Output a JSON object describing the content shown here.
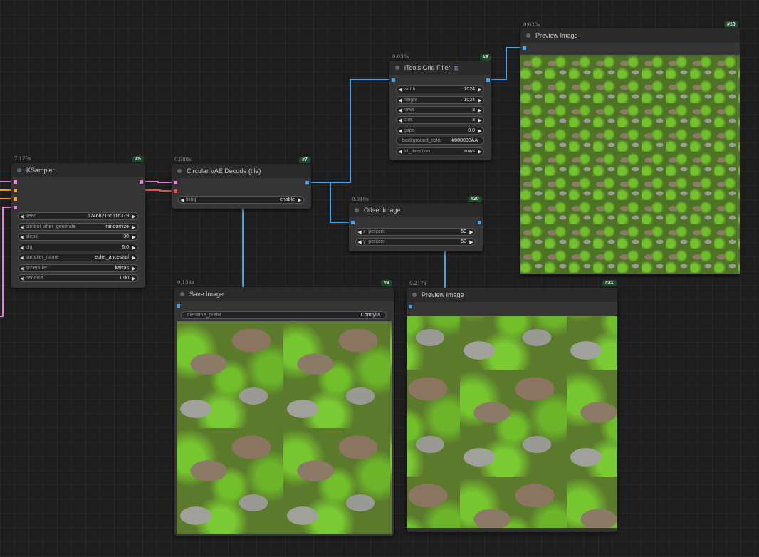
{
  "colors": {
    "wire_blue": "#4aa3e8",
    "wire_pink": "#e17fd8",
    "wire_orange": "#e6a032",
    "wire_red": "#e65050",
    "badge_bg": "#1f4a2b",
    "node_bg": "#353535"
  },
  "nodes": {
    "ksampler": {
      "id": "#5",
      "time": "7.176s",
      "title": "KSampler",
      "widgets": [
        {
          "label": "seed",
          "value": "174682155116379"
        },
        {
          "label": "control_after_generate",
          "value": "randomize"
        },
        {
          "label": "steps",
          "value": "30"
        },
        {
          "label": "cfg",
          "value": "6.0"
        },
        {
          "label": "sampler_name",
          "value": "euler_ancestral"
        },
        {
          "label": "scheduler",
          "value": "karras"
        },
        {
          "label": "denoise",
          "value": "1.00"
        }
      ]
    },
    "vae_decode": {
      "id": "#7",
      "time": "0.588s",
      "title": "Circular VAE Decode (tile)",
      "widgets": [
        {
          "label": "tiling",
          "value": "enable"
        }
      ]
    },
    "grid_filler": {
      "id": "#9",
      "time": "0.038s",
      "title": "iTools Grid Filler",
      "title_icon": "grid-icon",
      "widgets": [
        {
          "label": "width",
          "value": "1024"
        },
        {
          "label": "height",
          "value": "1024"
        },
        {
          "label": "rows",
          "value": "3"
        },
        {
          "label": "cols",
          "value": "3"
        },
        {
          "label": "gaps",
          "value": "0.0"
        },
        {
          "label": "background_color",
          "value": "#000000AA"
        },
        {
          "label": "fill_direction",
          "value": "rows"
        }
      ]
    },
    "preview10": {
      "id": "#10",
      "time": "0.030s",
      "title": "Preview Image"
    },
    "offset": {
      "id": "#20",
      "time": "0.010s",
      "title": "Offset Image",
      "widgets": [
        {
          "label": "x_percent",
          "value": "50"
        },
        {
          "label": "y_percent",
          "value": "50"
        }
      ]
    },
    "save": {
      "id": "#8",
      "time": "0.134s",
      "title": "Save Image",
      "widgets": [
        {
          "label": "filename_prefix",
          "value": "ComfyUI"
        }
      ]
    },
    "preview21": {
      "id": "#21",
      "time": "0.217s",
      "title": "Preview Image"
    }
  }
}
